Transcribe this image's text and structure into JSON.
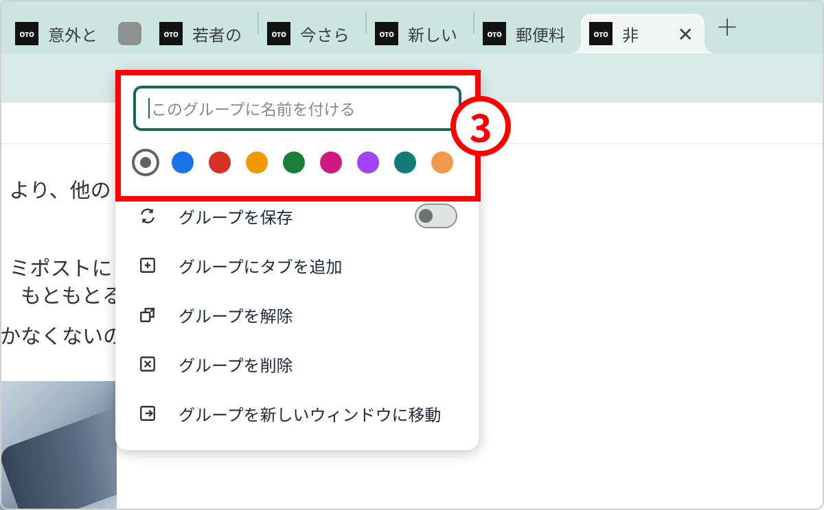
{
  "tabs": [
    {
      "title": "意外と"
    },
    {
      "title": "若者の"
    },
    {
      "title": "今さら"
    },
    {
      "title": "新しい"
    },
    {
      "title": "郵便料"
    },
    {
      "title": "非"
    }
  ],
  "popup": {
    "name_placeholder": "このグループに名前を付ける",
    "colors": {
      "grey": "#5f6368",
      "blue": "#1a73e8",
      "red": "#d93025",
      "yellow": "#f29900",
      "green": "#188038",
      "pink": "#d01884",
      "purple": "#a142f4",
      "teal": "#107b77",
      "orange": "#f2994a"
    },
    "menu": {
      "save": "グループを保存",
      "add_tab": "グループにタブを追加",
      "ungroup": "グループを解除",
      "delete": "グループを削除",
      "move": "グループを新しいウィンドウに移動"
    }
  },
  "page_text": {
    "line1": "より、他の",
    "line2": "ミポストに",
    "line3": "　もともとる",
    "line4": "かなくないの"
  },
  "annotation": {
    "number": "3"
  }
}
